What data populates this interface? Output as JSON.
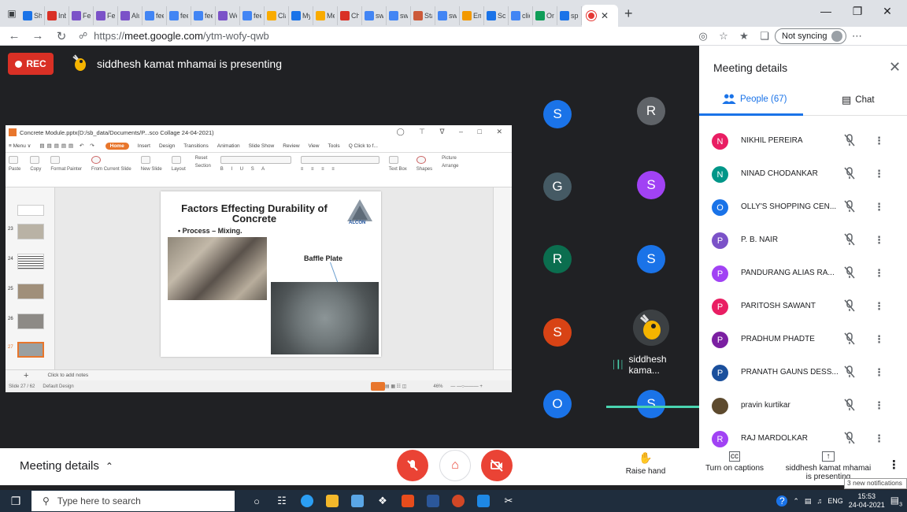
{
  "browser": {
    "tabs": [
      {
        "label": "Sh",
        "color": "#1a73e8"
      },
      {
        "label": "Inb",
        "color": "#d93025"
      },
      {
        "label": "Fee",
        "color": "#7b52c8"
      },
      {
        "label": "Fee",
        "color": "#7b52c8"
      },
      {
        "label": "Alu",
        "color": "#7b52c8"
      },
      {
        "label": "fee",
        "color": "#4285f4"
      },
      {
        "label": "fee",
        "color": "#4285f4"
      },
      {
        "label": "fee",
        "color": "#4285f4"
      },
      {
        "label": "We",
        "color": "#7b52c8"
      },
      {
        "label": "fee",
        "color": "#4285f4"
      },
      {
        "label": "Cla",
        "color": "#f9ab00"
      },
      {
        "label": "My",
        "color": "#1a73e8"
      },
      {
        "label": "Me",
        "color": "#f9ab00"
      },
      {
        "label": "Ch",
        "color": "#d93025"
      },
      {
        "label": "sw",
        "color": "#4285f4"
      },
      {
        "label": "sw",
        "color": "#4285f4"
      },
      {
        "label": "Sta",
        "color": "#cc5a3a"
      },
      {
        "label": "sw",
        "color": "#4285f4"
      },
      {
        "label": "Em",
        "color": "#f29900"
      },
      {
        "label": "Scr",
        "color": "#1a73e8"
      },
      {
        "label": "clic",
        "color": "#4285f4"
      },
      {
        "label": "On",
        "color": "#0f9d58"
      },
      {
        "label": "spi",
        "color": "#1a73e8"
      }
    ],
    "url_prefix": "https://",
    "url_host": "meet.google.com",
    "url_path": "/ytm-wofy-qwb",
    "sync_label": "Not syncing"
  },
  "meet": {
    "rec_label": "REC",
    "presenting_text": "siddhesh kamat mhamai is presenting",
    "presentation": {
      "file_title": "Concrete Module.pptx(D:/sb_data/Documents/P...sco Collage 24-04-2021)",
      "menu_items": [
        "≡ Menu ∨",
        "Home",
        "Insert",
        "Design",
        "Transitions",
        "Animation",
        "Slide Show",
        "Review",
        "View",
        "Tools",
        "Q Click to f..."
      ],
      "ribbon_labels": [
        "Paste",
        "Copy",
        "Format Painter",
        "From Current Slide",
        "New Slide",
        "Layout",
        "Reset",
        "Section",
        "Text Box",
        "Shapes",
        "Arrange",
        "Picture"
      ],
      "slide_title": "Factors Effecting Durability of Concrete",
      "slide_bullet": "•  Process – Mixing.",
      "logo_text": "ALCON",
      "baffle_label": "Baffle Plate",
      "thumb_numbers": [
        "23",
        "24",
        "25",
        "26",
        "27"
      ],
      "notes_placeholder": "Click to add notes",
      "status_slide": "Slide 27 / 62",
      "status_design": "Default Design",
      "zoom": "46%"
    },
    "participants": [
      {
        "initial": "S",
        "color": "#1a73e8"
      },
      {
        "initial": "R",
        "color": "#5f6368"
      },
      {
        "initial": "G",
        "color": "#455a64"
      },
      {
        "initial": "S",
        "color": "#a142f4"
      },
      {
        "initial": "R",
        "color": "#0b6e4f"
      },
      {
        "initial": "S",
        "color": "#1a73e8"
      },
      {
        "initial": "S",
        "color": "#d84315"
      },
      {
        "initial": "O",
        "color": "#1a73e8"
      },
      {
        "initial": "S",
        "color": "#1a73e8"
      }
    ],
    "active_speaker": "siddhesh kama..."
  },
  "bottombar": {
    "meeting_details": "Meeting details",
    "raise_hand": "Raise hand",
    "captions": "Turn on captions",
    "presenting_line1": "siddhesh kamat mhamai",
    "presenting_line2": "is presenting",
    "notification": "3 new notifications"
  },
  "panel": {
    "title": "Meeting details",
    "people_tab": "People (67)",
    "chat_tab": "Chat",
    "people": [
      {
        "initial": "N",
        "name": "NIKHIL PEREIRA",
        "color": "#e91e63"
      },
      {
        "initial": "N",
        "name": "NINAD CHODANKAR",
        "color": "#009688"
      },
      {
        "initial": "O",
        "name": "OLLY'S SHOPPING CEN...",
        "color": "#1a73e8"
      },
      {
        "initial": "P",
        "name": "P. B. NAIR",
        "color": "#7b52c8"
      },
      {
        "initial": "P",
        "name": "PANDURANG ALIAS RA...",
        "color": "#a142f4"
      },
      {
        "initial": "P",
        "name": "PARITOSH SAWANT",
        "color": "#e91e63"
      },
      {
        "initial": "P",
        "name": "PRADHUM PHADTE",
        "color": "#7b1fa2"
      },
      {
        "initial": "P",
        "name": "PRANATH GAUNS DESS...",
        "color": "#1a4f9c"
      },
      {
        "initial": "",
        "name": "pravin kurtikar",
        "color": "#5d4a2e"
      },
      {
        "initial": "R",
        "name": "RAJ MARDOLKAR",
        "color": "#a142f4"
      }
    ]
  },
  "taskbar": {
    "search_placeholder": "Type here to search",
    "lang": "ENG",
    "time": "15:53",
    "date": "24-04-2021",
    "notif_count": "3"
  }
}
